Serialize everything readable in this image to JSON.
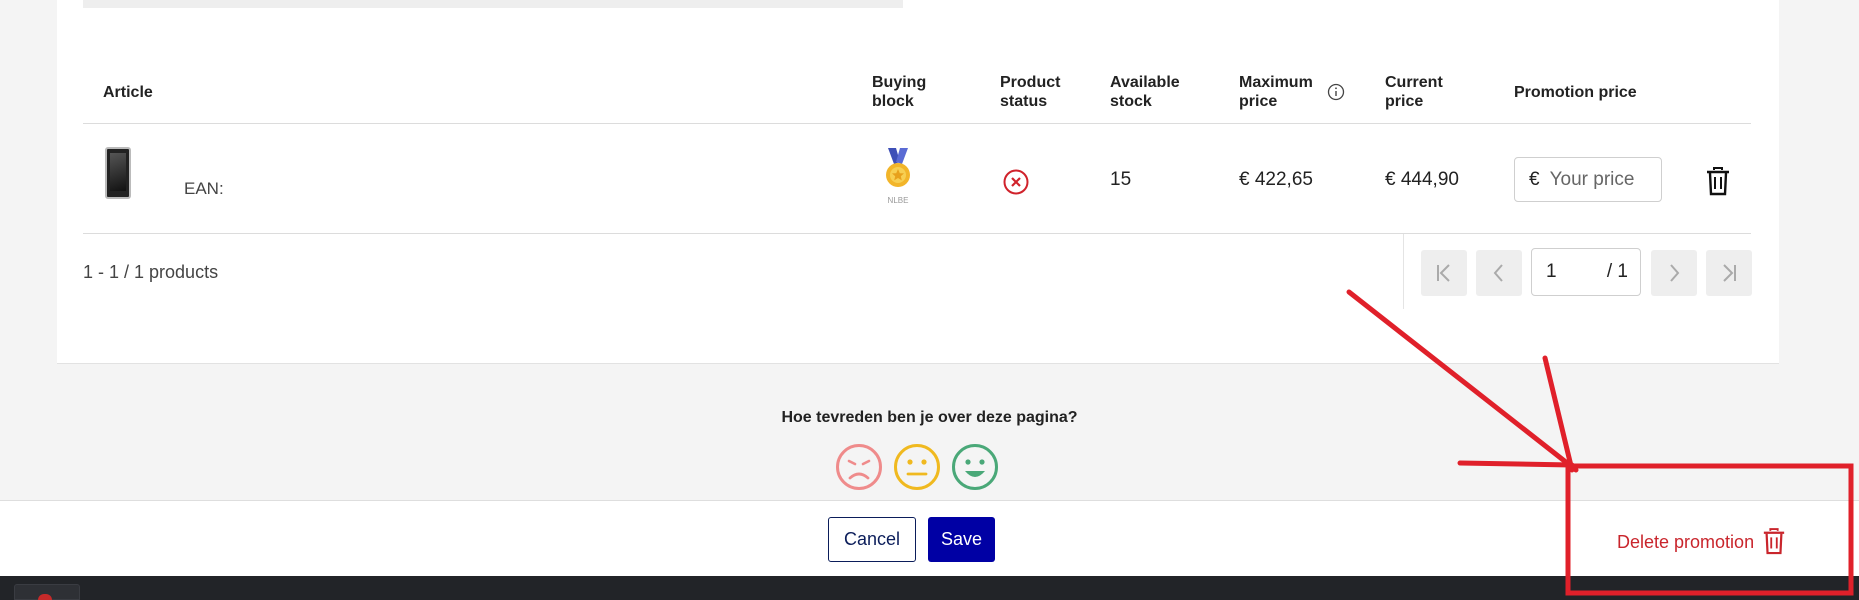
{
  "table": {
    "headers": {
      "article": "Article",
      "buying_block": [
        "Buying",
        "block"
      ],
      "product_status": [
        "Product",
        "status"
      ],
      "available_stock": [
        "Available",
        "stock"
      ],
      "maximum_price": [
        "Maximum",
        "price"
      ],
      "current_price": [
        "Current",
        "price"
      ],
      "promotion_price": "Promotion price"
    },
    "rows": [
      {
        "ean_label": "EAN:",
        "buying_block_badge": "NLBE",
        "product_status": "x-circle-icon",
        "available_stock": "15",
        "maximum_price": "€ 422,65",
        "current_price": "€ 444,90",
        "promo_currency": "€",
        "promo_placeholder": "Your price"
      }
    ]
  },
  "pagination": {
    "summary": "1 - 1 / 1 products",
    "current_page": "1",
    "total_pages": "/ 1"
  },
  "feedback": {
    "question": "Hoe tevreden ben je over deze pagina?"
  },
  "footer": {
    "cancel_label": "Cancel",
    "save_label": "Save",
    "delete_label": "Delete promotion"
  },
  "colors": {
    "save": "#0000a4",
    "delete": "#c9252c",
    "annotation": "#e0202a",
    "sad": "#ef8b8b",
    "neutral": "#f0b91f",
    "happy": "#4aa878"
  }
}
